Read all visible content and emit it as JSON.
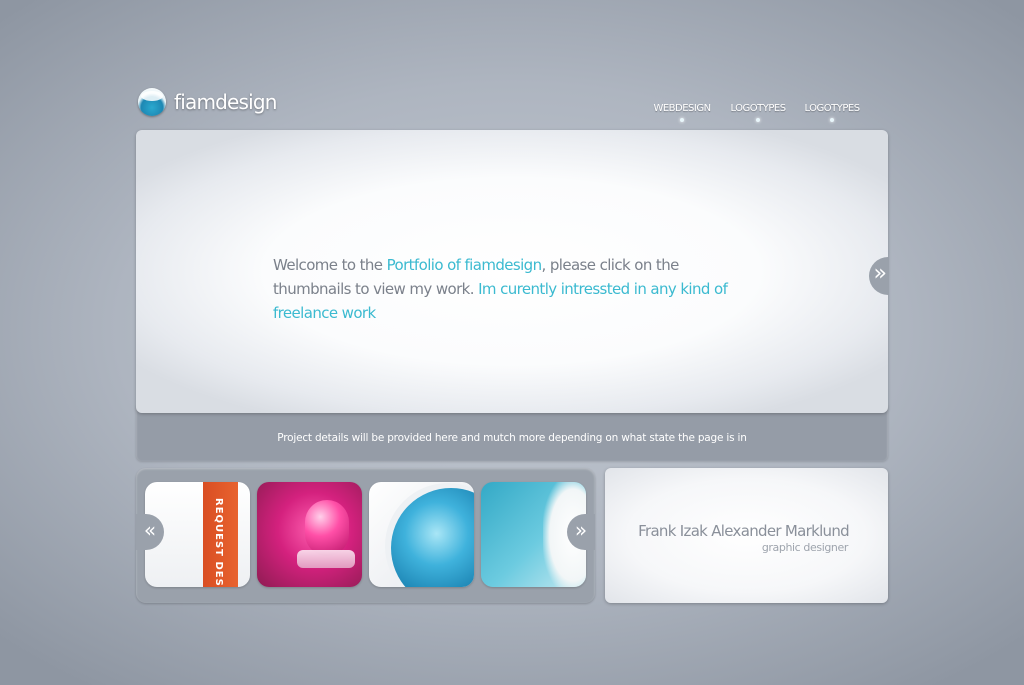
{
  "brand": {
    "name": "fiamdesign",
    "logo_icon": "droplet-logo-icon"
  },
  "nav": {
    "items": [
      {
        "label": "WEBDESIGN"
      },
      {
        "label": "LOGOTYPES"
      },
      {
        "label": "LOGOTYPES"
      }
    ]
  },
  "hero": {
    "text_part1": "Welcome to the ",
    "text_highlight1": "Portfolio of fiamdesign",
    "text_part2": ", please click on the thumbnails to view my work. ",
    "text_highlight2": "Im curently intressted in any kind of freelance work",
    "next_label": "»"
  },
  "details": {
    "text": "Project details will be provided here and mutch more depending on what state the page is in"
  },
  "thumbnails": {
    "prev_label": "«",
    "next_label": "»",
    "items": [
      {
        "caption": "REQUEST DESIG"
      },
      {
        "caption": ""
      },
      {
        "caption": ""
      },
      {
        "caption": ""
      }
    ]
  },
  "card": {
    "name": "Frank Izak Alexander Marklund",
    "role": "graphic designer"
  },
  "colors": {
    "accent": "#3bbad0",
    "panel_gray": "#9aa1ab",
    "ribbon_orange": "#e8632f"
  }
}
